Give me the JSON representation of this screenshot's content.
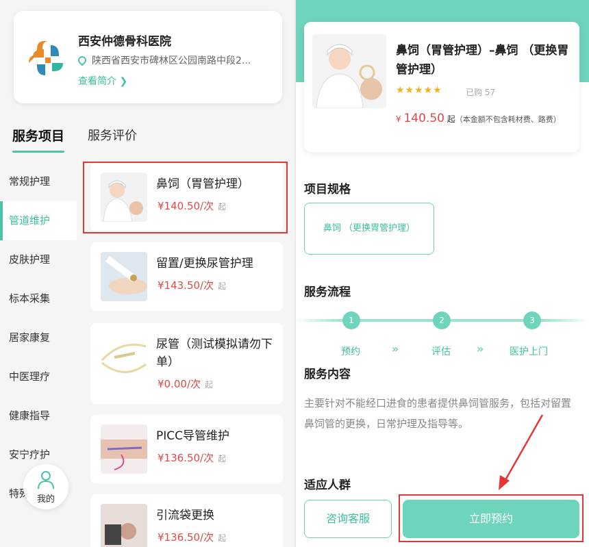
{
  "hospital": {
    "name": "西安仲德骨科医院",
    "address": "陕西省西安市碑林区公园南路中段2...",
    "intro_link": "查看简介 ❯"
  },
  "tabs": [
    "服务项目",
    "服务评价"
  ],
  "sidebar": {
    "items": [
      {
        "label": "常规护理"
      },
      {
        "label": "管道维护"
      },
      {
        "label": "皮肤护理"
      },
      {
        "label": "标本采集"
      },
      {
        "label": "居家康复"
      },
      {
        "label": "中医理疗"
      },
      {
        "label": "健康指导"
      },
      {
        "label": "安宁疗护"
      },
      {
        "label": "特殊"
      }
    ]
  },
  "mine_button": {
    "label": "我的",
    "icon": "person-icon"
  },
  "services": [
    {
      "title": "鼻饲（胃管护理）",
      "price": "¥140.50/次",
      "qi": "起"
    },
    {
      "title": "留置/更换尿管护理",
      "price": "¥143.50/次",
      "qi": "起"
    },
    {
      "title": "尿管（测试模拟请勿下单）",
      "price": "¥0.00/次",
      "qi": "起"
    },
    {
      "title": "PICC导管维护",
      "price": "¥136.50/次",
      "qi": "起"
    },
    {
      "title": "引流袋更换",
      "price": "¥136.50/次",
      "qi": "起"
    }
  ],
  "detail": {
    "title": "鼻饲（胃管护理）–鼻饲 （更换胃管护理）",
    "rating": 5,
    "stars": "★★★★★",
    "sold": "已购 57",
    "currency": "¥",
    "price": "140.50",
    "price_suffix": "起",
    "price_note": "（本金额不包含耗材费、路费）",
    "spec_title": "项目规格",
    "spec_option": "鼻饲 （更换胃管护理）",
    "process_title": "服务流程",
    "steps": [
      {
        "num": "1",
        "label": "预约"
      },
      {
        "num": "2",
        "label": "评估"
      },
      {
        "num": "3",
        "label": "医护上门"
      }
    ],
    "step_arrow": "»",
    "content_title": "服务内容",
    "content_text": "主要针对不能经口进食的患者提供鼻饲管服务，包括对留置鼻饲管的更换，日常护理及指导等。",
    "audience_title": "适应人群",
    "consult_button": "咨询客服",
    "book_button": "立即预约"
  },
  "colors": {
    "accent": "#6fd4bc",
    "accent_text": "#3cbf9f",
    "price": "#e04848",
    "highlight": "#e53535",
    "star": "#f6b01e"
  }
}
